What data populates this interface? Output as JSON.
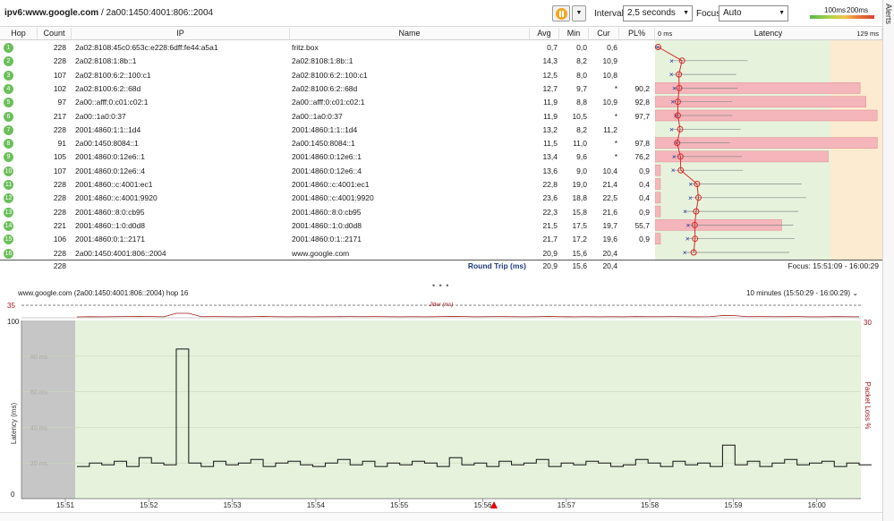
{
  "header": {
    "target_bold": "ipv6:www.google.com",
    "target_rest": " / 2a00:1450:4001:806::2004",
    "interval_label": "Interval",
    "interval_value": "2,5 seconds",
    "focus_label": "Focus",
    "focus_value": "Auto",
    "legend_100": "100ms",
    "legend_200": "200ms",
    "alerts_label": "Alerts"
  },
  "columns": {
    "hop": "Hop",
    "count": "Count",
    "ip": "IP",
    "name": "Name",
    "avg": "Avg",
    "min": "Min",
    "cur": "Cur",
    "pl": "PL%",
    "latency": "Latency",
    "lat_min": "0 ms",
    "lat_max": "129 ms"
  },
  "hops": [
    {
      "hop": "1",
      "count": "228",
      "ip": "2a02:8108:45c0:653c:e228:6dff:fe44:a5a1",
      "name": "fritz.box",
      "avg": "0,7",
      "min": "0,0",
      "cur": "0,6",
      "pl": ""
    },
    {
      "hop": "2",
      "count": "228",
      "ip": "2a02:8108:1:8b::1",
      "name": "2a02:8108:1:8b::1",
      "avg": "14,3",
      "min": "8,2",
      "cur": "10,9",
      "pl": ""
    },
    {
      "hop": "3",
      "count": "107",
      "ip": "2a02:8100:6:2::100:c1",
      "name": "2a02:8100:6:2::100:c1",
      "avg": "12,5",
      "min": "8,0",
      "cur": "10,8",
      "pl": ""
    },
    {
      "hop": "4",
      "count": "102",
      "ip": "2a02:8100:6:2::68d",
      "name": "2a02:8100:6:2::68d",
      "avg": "12,7",
      "min": "9,7",
      "cur": "*",
      "pl": "90,2"
    },
    {
      "hop": "5",
      "count": "97",
      "ip": "2a00::afff:0:c01:c02:1",
      "name": "2a00::afff:0:c01:c02:1",
      "avg": "11,9",
      "min": "8,8",
      "cur": "10,9",
      "pl": "92,8"
    },
    {
      "hop": "6",
      "count": "217",
      "ip": "2a00::1a0:0:37",
      "name": "2a00::1a0:0:37",
      "avg": "11,9",
      "min": "10,5",
      "cur": "*",
      "pl": "97,7"
    },
    {
      "hop": "7",
      "count": "228",
      "ip": "2001:4860:1:1::1d4",
      "name": "2001:4860:1:1::1d4",
      "avg": "13,2",
      "min": "8,2",
      "cur": "11,2",
      "pl": ""
    },
    {
      "hop": "8",
      "count": "91",
      "ip": "2a00:1450:8084::1",
      "name": "2a00:1450:8084::1",
      "avg": "11,5",
      "min": "11,0",
      "cur": "*",
      "pl": "97,8"
    },
    {
      "hop": "9",
      "count": "105",
      "ip": "2001:4860:0:12e6::1",
      "name": "2001:4860:0:12e6::1",
      "avg": "13,4",
      "min": "9,6",
      "cur": "*",
      "pl": "76,2"
    },
    {
      "hop": "10",
      "count": "107",
      "ip": "2001:4860:0:12e6::4",
      "name": "2001:4860:0:12e6::4",
      "avg": "13,6",
      "min": "9,0",
      "cur": "10,4",
      "pl": "0,9"
    },
    {
      "hop": "11",
      "count": "228",
      "ip": "2001:4860::c:4001:ec1",
      "name": "2001:4860::c:4001:ec1",
      "avg": "22,8",
      "min": "19,0",
      "cur": "21,4",
      "pl": "0,4"
    },
    {
      "hop": "12",
      "count": "228",
      "ip": "2001:4860::c:4001:9920",
      "name": "2001:4860::c:4001:9920",
      "avg": "23,6",
      "min": "18,8",
      "cur": "22,5",
      "pl": "0,4"
    },
    {
      "hop": "13",
      "count": "228",
      "ip": "2001:4860::8:0:cb95",
      "name": "2001:4860::8:0:cb95",
      "avg": "22,3",
      "min": "15,8",
      "cur": "21,6",
      "pl": "0,9"
    },
    {
      "hop": "14",
      "count": "221",
      "ip": "2001:4860::1:0:d0d8",
      "name": "2001:4860::1:0:d0d8",
      "avg": "21,5",
      "min": "17,5",
      "cur": "19,7",
      "pl": "55,7"
    },
    {
      "hop": "15",
      "count": "106",
      "ip": "2001:4860:0:1::2171",
      "name": "2001:4860:0:1::2171",
      "avg": "21,7",
      "min": "17,2",
      "cur": "19,6",
      "pl": "0,9"
    },
    {
      "hop": "16",
      "count": "228",
      "ip": "2a00:1450:4001:806::2004",
      "name": "www.google.com",
      "avg": "20,9",
      "min": "15,6",
      "cur": "20,4",
      "pl": ""
    }
  ],
  "summary": {
    "count": "228",
    "label": "Round Trip (ms)",
    "avg": "20,9",
    "min": "15,6",
    "cur": "20,4",
    "focus_range": "Focus: 15:51:09 - 16:00:29"
  },
  "graph": {
    "title": "www.google.com (2a00:1450:4001:806::2004) hop 16",
    "range": "10 minutes (15:50:29 - 16:00:29)",
    "jitter_label": "Jitter (ms)",
    "jitter_max": "35",
    "latency_max": "100",
    "latency_min": "0",
    "loss_max": "30",
    "ylabel": "Latency (ms)",
    "y2label": "Packet Loss %",
    "gridlabels": [
      "80 ms",
      "60 ms",
      "40 ms",
      "20 ms"
    ],
    "time_ticks": [
      "15:51",
      "15:52",
      "15:53",
      "15:54",
      "15:55",
      "15:56",
      "15:57",
      "15:58",
      "15:59",
      "16:00"
    ]
  },
  "colors": {
    "green_zone": "#e6f2dc",
    "yellow_zone": "#fcebd0",
    "loss_bar": "#f4b6bb",
    "hop_circle": "#6bbf59",
    "trace_line": "#d42a2a"
  },
  "chart_data": {
    "type": "line",
    "title": "www.google.com (2a00:1450:4001:806::2004) hop 16",
    "xlabel": "",
    "ylabel": "Latency (ms)",
    "ylim": [
      0,
      100
    ],
    "x": [
      "15:51",
      "15:52",
      "15:53",
      "15:54",
      "15:55",
      "15:56",
      "15:57",
      "15:58",
      "15:59",
      "16:00"
    ],
    "series": [
      {
        "name": "Latency (ms)",
        "values": [
          18,
          20,
          19,
          21,
          18,
          23,
          20,
          19,
          84,
          20,
          18,
          21,
          19,
          20,
          22,
          18,
          20,
          21,
          19,
          18,
          20,
          22,
          19,
          21,
          18,
          20,
          19,
          21,
          20,
          18,
          23,
          19,
          20,
          18,
          21,
          19,
          20,
          22,
          18,
          20,
          19,
          21,
          20,
          18,
          19,
          22,
          20,
          18,
          21,
          19,
          20,
          18,
          30,
          19,
          21,
          18,
          20,
          22,
          19,
          20,
          21,
          18,
          20,
          19
        ]
      }
    ]
  }
}
